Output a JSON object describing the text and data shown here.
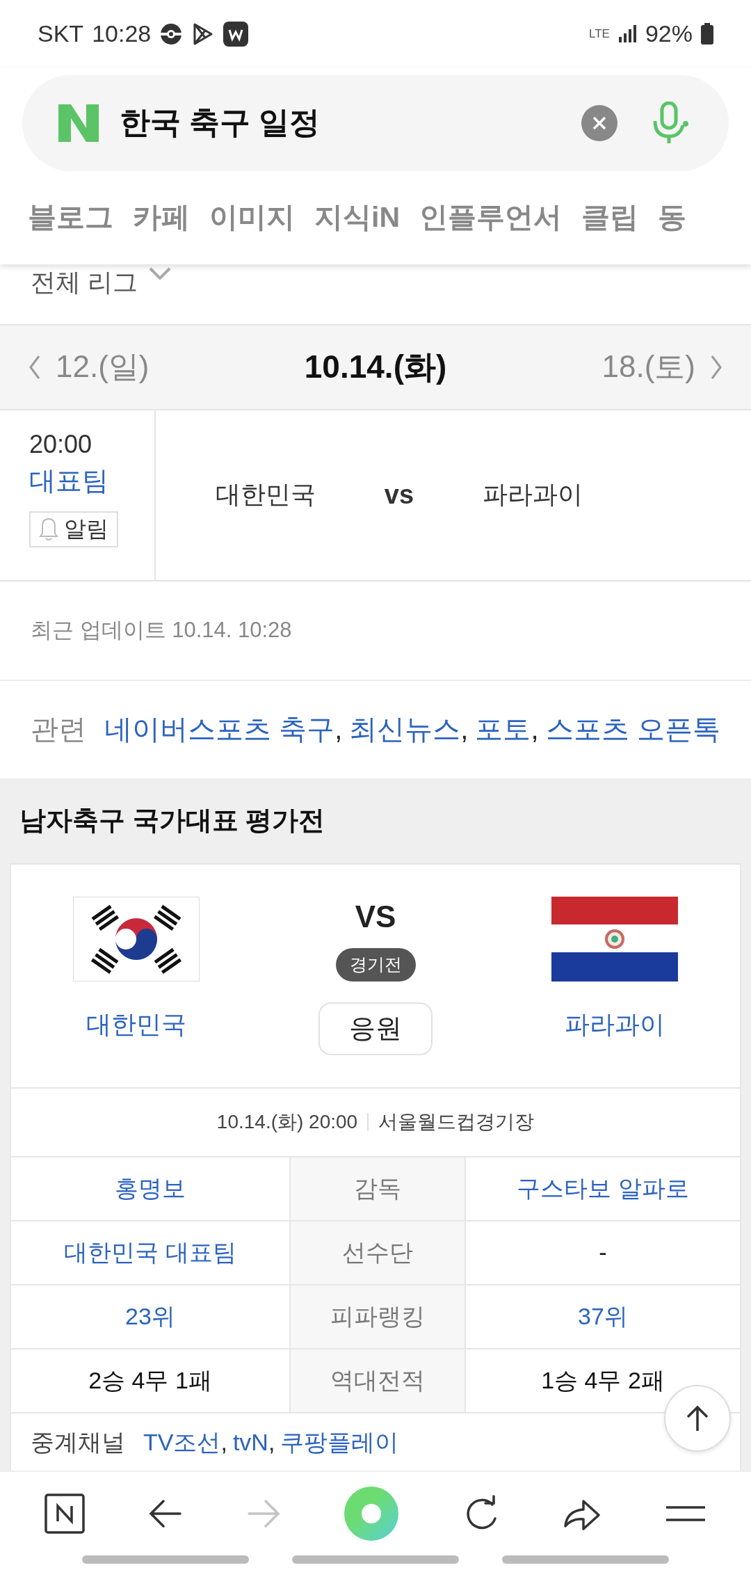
{
  "status_bar": {
    "carrier": "SKT",
    "time": "10:28",
    "network": "LTE",
    "battery": "92%"
  },
  "search": {
    "value": "한국 축구 일정"
  },
  "tabs": [
    {
      "label": "블로그"
    },
    {
      "label": "카페"
    },
    {
      "label": "이미지"
    },
    {
      "label": "지식iN"
    },
    {
      "label": "인플루언서"
    },
    {
      "label": "클립"
    },
    {
      "label": "동"
    }
  ],
  "league_filter": {
    "label": "전체 리그"
  },
  "date_nav": {
    "prev": "12.(일)",
    "current": "10.14.(화)",
    "next": "18.(토)"
  },
  "matches": [
    {
      "time": "20:00",
      "category": "대표팀",
      "alarm": "알림",
      "home": "대한민국",
      "vs": "vs",
      "away": "파라과이"
    }
  ],
  "updated": "최근 업데이트 10.14. 10:28",
  "related": {
    "label": "관련",
    "separator": ",",
    "links": [
      "네이버스포츠 축구",
      "최신뉴스",
      "포토",
      "스포츠 오픈톡"
    ]
  },
  "game": {
    "title": "남자축구 국가대표 평가전",
    "home": {
      "name": "대한민국"
    },
    "vs": "VS",
    "status": "경기전",
    "cheer": "응원",
    "away": {
      "name": "파라과이"
    },
    "info": {
      "datetime": "10.14.(화) 20:00",
      "venue": "서울월드컵경기장"
    },
    "rows": [
      {
        "home": {
          "text": "홍명보",
          "link": true
        },
        "label": "감독",
        "away": {
          "text": "구스타보 알파로",
          "link": true
        }
      },
      {
        "home": {
          "text": "대한민국 대표팀",
          "link": true
        },
        "label": "선수단",
        "away": {
          "text": "-",
          "link": false
        }
      },
      {
        "home": {
          "text": "23위",
          "link": true
        },
        "label": "피파랭킹",
        "away": {
          "text": "37위",
          "link": true
        }
      },
      {
        "home": {
          "text": "2승 4무 1패",
          "link": false
        },
        "label": "역대전적",
        "away": {
          "text": "1승 4무 2패",
          "link": false
        }
      }
    ],
    "broadcast": {
      "label": "중계채널",
      "separator": ",",
      "channels": [
        "TV조선",
        "tvN",
        "쿠팡플레이"
      ]
    }
  },
  "toolbar": {
    "forward_enabled": false
  }
}
